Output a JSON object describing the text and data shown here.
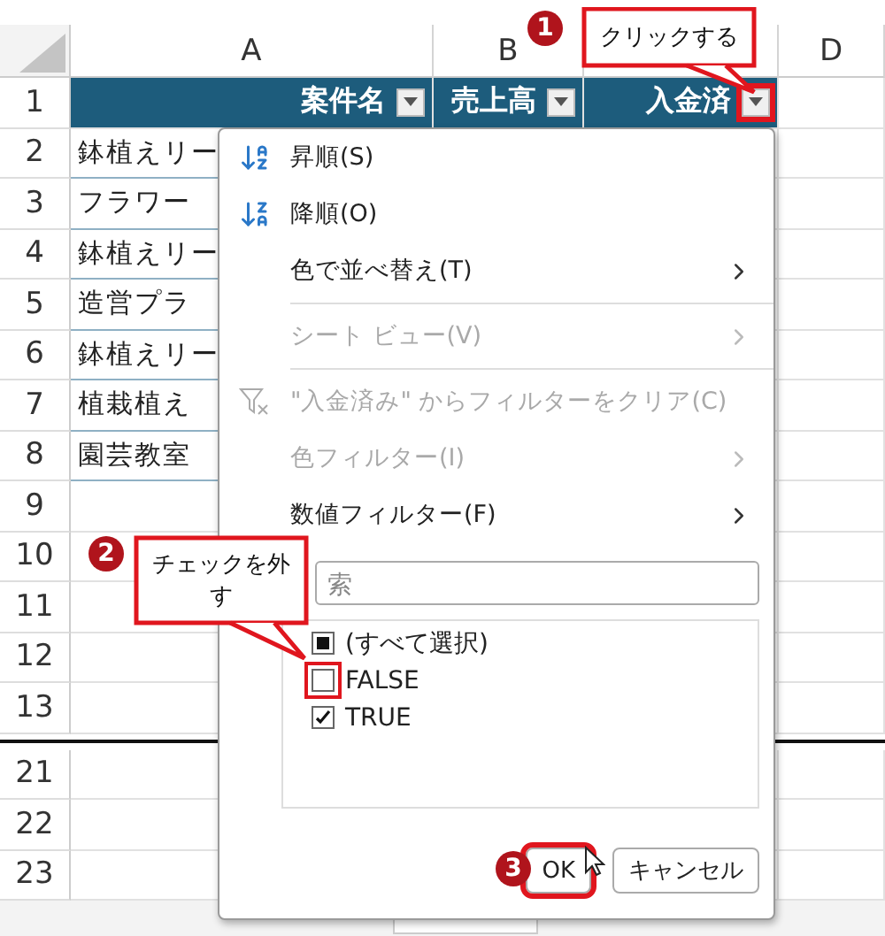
{
  "column_headers": [
    "A",
    "B",
    "D"
  ],
  "row_blocks": [
    {
      "rows": [
        {
          "number": "1",
          "kind": "header",
          "cells": [
            {
              "text": "案件名",
              "highlighted": false
            },
            {
              "text": "売上高",
              "highlighted": false
            },
            {
              "text": "入金済",
              "highlighted": true
            }
          ]
        },
        {
          "number": "2",
          "kind": "data",
          "cells": [
            {
              "text": "鉢植えリー"
            }
          ]
        },
        {
          "number": "3",
          "kind": "data",
          "cells": [
            {
              "text": "フラワー"
            }
          ]
        },
        {
          "number": "4",
          "kind": "data",
          "cells": [
            {
              "text": "鉢植えリー"
            }
          ]
        },
        {
          "number": "5",
          "kind": "data",
          "cells": [
            {
              "text": "造営プラ"
            }
          ]
        },
        {
          "number": "6",
          "kind": "data",
          "cells": [
            {
              "text": "鉢植えリー"
            }
          ]
        },
        {
          "number": "7",
          "kind": "data",
          "cells": [
            {
              "text": "植栽植え"
            }
          ]
        },
        {
          "number": "8",
          "kind": "data",
          "cells": [
            {
              "text": "園芸教室"
            }
          ]
        },
        {
          "number": "9",
          "kind": "empty"
        },
        {
          "number": "10",
          "kind": "empty"
        },
        {
          "number": "11",
          "kind": "empty"
        },
        {
          "number": "12",
          "kind": "empty"
        },
        {
          "number": "13",
          "kind": "empty"
        }
      ]
    },
    {
      "rows": [
        {
          "number": "21",
          "kind": "empty"
        },
        {
          "number": "22",
          "kind": "empty"
        },
        {
          "number": "23",
          "kind": "empty"
        }
      ]
    }
  ],
  "filter_menu": {
    "items": [
      {
        "kind": "sort-asc",
        "label": "昇順(S)",
        "disabled": false
      },
      {
        "kind": "sort-desc",
        "label": "降順(O)",
        "disabled": false
      },
      {
        "kind": "submenu",
        "label": "色で並べ替え(T)",
        "disabled": false
      },
      {
        "kind": "divider"
      },
      {
        "kind": "submenu",
        "label": "シート ビュー(V)",
        "disabled": true
      },
      {
        "kind": "divider"
      },
      {
        "kind": "clear-filter",
        "label": "\"入金済み\" からフィルターをクリア(C)",
        "disabled": true
      },
      {
        "kind": "submenu",
        "label": "色フィルター(I)",
        "disabled": true
      },
      {
        "kind": "submenu",
        "label": "数値フィルター(F)",
        "disabled": false
      }
    ],
    "search": {
      "placeholder": "索"
    },
    "values": [
      {
        "label": "(すべて選択)",
        "checked": false,
        "mixed": true,
        "highlighted": false
      },
      {
        "label": "FALSE",
        "checked": false,
        "mixed": false,
        "highlighted": true
      },
      {
        "label": "TRUE",
        "checked": true,
        "mixed": false,
        "highlighted": false
      }
    ],
    "buttons": [
      {
        "label": "OK",
        "highlighted": true
      },
      {
        "label": "キャンセル",
        "highlighted": false
      }
    ]
  },
  "callouts": [
    {
      "step": "1",
      "text": "クリックする"
    },
    {
      "step": "2",
      "text": "チェックを外す"
    },
    {
      "step": "3"
    }
  ]
}
